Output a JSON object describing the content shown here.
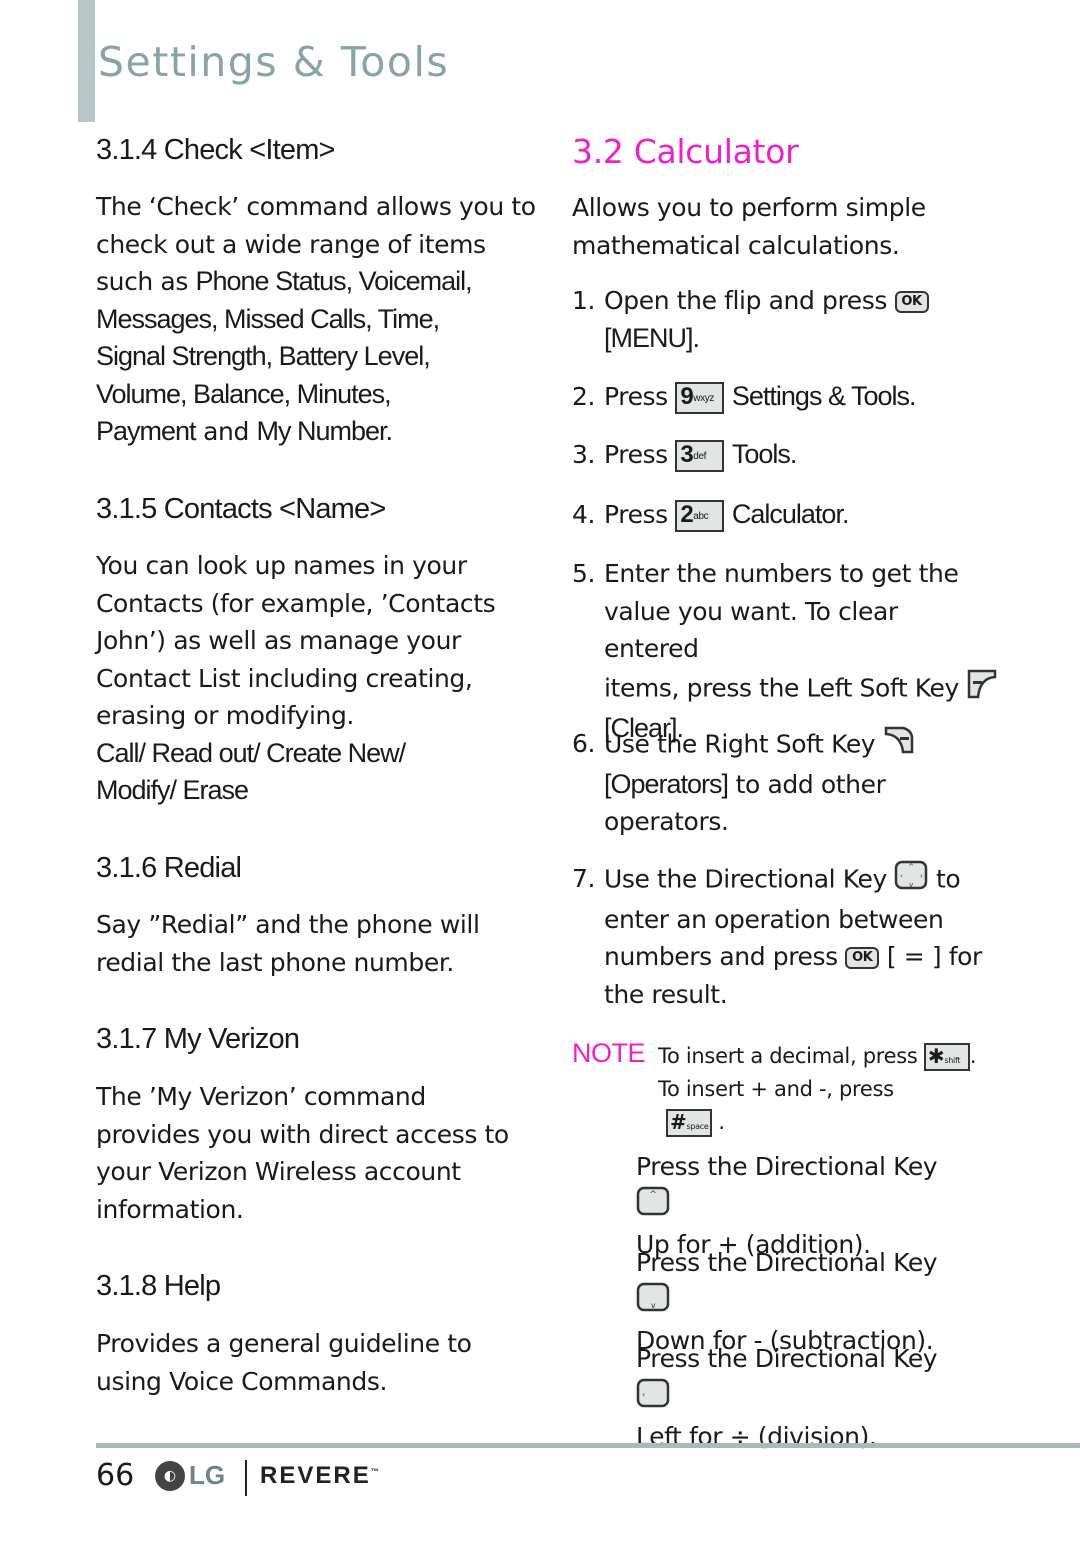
{
  "header": {
    "title": "Settings & Tools"
  },
  "left": {
    "sections": [
      {
        "heading": "3.1.4 Check <Item>",
        "lines": [
          "The ‘Check’ command allows you to",
          "check out a wide range of items",
          "such as ",
          "Phone Status, Voicemail,",
          "Messages, Missed Calls, Time,",
          "Signal Strength, Battery Level,",
          "Volume, Balance, Minutes,",
          "Payment",
          " and ",
          "My Number."
        ]
      },
      {
        "heading": "3.1.5 Contacts <Name>",
        "lines": [
          "You can look up names in your",
          "Contacts (for example, ’Contacts",
          "John’) as well as manage your",
          "Contact List including creating,",
          "erasing or modifying.",
          "Call/ Read out/ Create New/",
          "Modify/ Erase"
        ]
      },
      {
        "heading": "3.1.6 Redial",
        "lines": [
          "Say ”Redial” and the phone will",
          "redial the last phone number."
        ]
      },
      {
        "heading": "3.1.7 My Verizon",
        "lines": [
          "The ’My Verizon’ command",
          "provides you with direct access to",
          "your Verizon Wireless account",
          "information."
        ]
      },
      {
        "heading": "3.1.8 Help",
        "lines": [
          "Provides a general guideline to",
          "using Voice Commands."
        ]
      }
    ]
  },
  "right": {
    "title": "3.2 Calculator",
    "intro": [
      "Allows you to perform simple",
      "mathematical calculations."
    ],
    "steps": [
      {
        "num": "1.",
        "text": "Open the flip and press",
        "key": "OK",
        "cont": "[MENU]."
      },
      {
        "num": "2.",
        "text": "Press",
        "key_digit": "9",
        "key_letters": "wxyz",
        "cont": "Settings & Tools."
      },
      {
        "num": "3.",
        "text": "Press",
        "key_digit": "3",
        "key_letters": "def",
        "cont": "Tools."
      },
      {
        "num": "4.",
        "text": "Press",
        "key_digit": "2",
        "key_letters": "abc",
        "cont": "Calculator."
      },
      {
        "num": "5.",
        "lines": [
          "Enter the numbers to get the",
          "value you want. To clear entered",
          "items, press the Left Soft Key",
          "[Clear]."
        ]
      },
      {
        "num": "6.",
        "lines": [
          "Use the Right Soft Key",
          "[Operators]",
          " to add other",
          "operators."
        ]
      },
      {
        "num": "7.",
        "lines": [
          "Use the Directional Key",
          "to",
          "enter an operation between",
          "numbers and press",
          "[ = ] for",
          "the result."
        ]
      }
    ],
    "note": {
      "label": "NOTE",
      "line1": "To insert a decimal, press",
      "key1_main": "✱",
      "key1_sub": "shift",
      "line2": "To insert + and -, press",
      "key2_main": "#",
      "key2_sub": "space",
      "period": "."
    },
    "directional": [
      {
        "line1": "Press the Directional Key",
        "line2": "Up for + (addition).",
        "dir": "up"
      },
      {
        "line1": "Press the Directional Key",
        "line2": "Down for - (subtraction).",
        "dir": "down"
      },
      {
        "line1": "Press the Directional Key",
        "line2": "Left for ÷ (division).",
        "dir": "left"
      }
    ]
  },
  "footer": {
    "page_number": "66",
    "lg_logo": "LG",
    "brand": "REVERE",
    "tm": "™"
  },
  "colors": {
    "accent": "#ee20c8",
    "title_gray": "#8aa3a7",
    "bar": "#b6c6ca"
  }
}
